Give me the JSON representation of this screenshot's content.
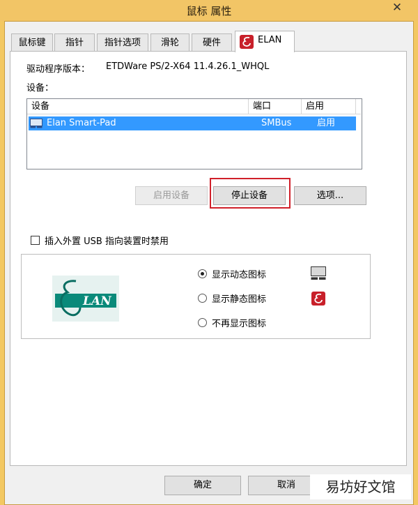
{
  "window": {
    "title": "鼠标 属性",
    "close_glyph": "✕"
  },
  "tabs": [
    {
      "label": "鼠标键"
    },
    {
      "label": "指针"
    },
    {
      "label": "指针选项"
    },
    {
      "label": "滑轮"
    },
    {
      "label": "硬件"
    },
    {
      "label": "ELAN"
    }
  ],
  "driver": {
    "label": "驱动程序版本：",
    "value": "ETDWare PS/2-X64 11.4.26.1_WHQL"
  },
  "devices": {
    "label": "设备：",
    "columns": [
      "设备",
      "端口",
      "启用"
    ],
    "rows": [
      {
        "name": "Elan Smart-Pad",
        "port": "SMBus",
        "enabled": "启用"
      }
    ]
  },
  "buttons": {
    "enable": "启用设备",
    "stop": "停止设备",
    "options": "选项..."
  },
  "usb_checkbox": {
    "label": "插入外置 USB 指向装置时禁用",
    "checked": false
  },
  "icon_options": [
    {
      "label": "显示动态图标",
      "selected": true
    },
    {
      "label": "显示静态图标",
      "selected": false
    },
    {
      "label": "不再显示图标",
      "selected": false
    }
  ],
  "logo": {
    "text": "LAN"
  },
  "footer": {
    "ok": "确定",
    "cancel": "取消"
  },
  "watermark": "易坊好文馆",
  "colors": {
    "accent": "#3399ff",
    "highlight_box": "#d0202a",
    "logo_teal": "#0a8a7a",
    "tab_logo_red": "#c8202a"
  }
}
